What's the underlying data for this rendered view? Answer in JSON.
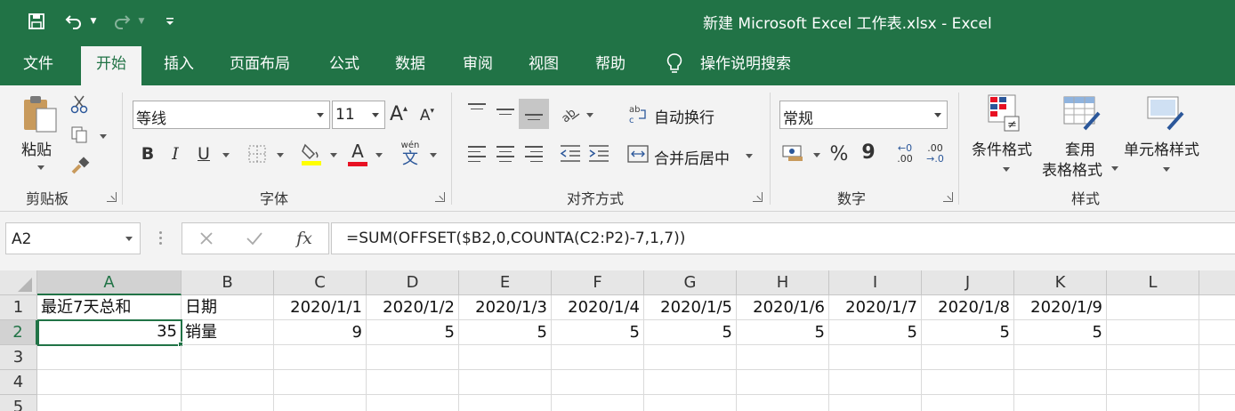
{
  "window": {
    "title": "新建 Microsoft Excel 工作表.xlsx  -  Excel"
  },
  "quick_access": {
    "icons": [
      "save-icon",
      "undo-icon",
      "redo-icon",
      "customize-qat-icon"
    ]
  },
  "tabs": [
    {
      "label": "文件"
    },
    {
      "label": "开始"
    },
    {
      "label": "插入"
    },
    {
      "label": "页面布局"
    },
    {
      "label": "公式"
    },
    {
      "label": "数据"
    },
    {
      "label": "审阅"
    },
    {
      "label": "视图"
    },
    {
      "label": "帮助"
    }
  ],
  "tell_me": {
    "label": "操作说明搜索"
  },
  "ribbon": {
    "clipboard": {
      "label": "剪贴板",
      "paste": "粘贴"
    },
    "font": {
      "label": "字体",
      "font_name": "等线",
      "font_size": "11",
      "bold": "B",
      "italic": "I",
      "underline": "U",
      "grow": "A",
      "shrink": "A",
      "wen": "wén",
      "wen_char": "文",
      "font_color_letter": "A"
    },
    "alignment": {
      "label": "对齐方式",
      "wrap": "自动换行",
      "merge": "合并后居中"
    },
    "number": {
      "label": "数字",
      "format": "常规",
      "percent": "%",
      "comma": "9",
      "inc_dec_top": "←0",
      "inc_dec_bottom": ".00",
      "dec_dec_top": ".00",
      "dec_dec_bottom": "→.0"
    },
    "styles": {
      "label": "样式",
      "conditional": "条件格式",
      "table_1": "套用",
      "table_2": "表格格式",
      "cell_styles": "单元格样式"
    }
  },
  "formula_bar": {
    "name_box": "A2",
    "formula": "=SUM(OFFSET($B2,0,COUNTA(C2:P2)-7,1,7))",
    "fx": "fx"
  },
  "sheet": {
    "columns": [
      "A",
      "B",
      "C",
      "D",
      "E",
      "F",
      "G",
      "H",
      "I",
      "J",
      "K",
      "L"
    ],
    "rows": [
      "1",
      "2",
      "3",
      "4",
      "5"
    ],
    "row1": [
      "最近7天总和",
      "日期",
      "2020/1/1",
      "2020/1/2",
      "2020/1/3",
      "2020/1/4",
      "2020/1/5",
      "2020/1/6",
      "2020/1/7",
      "2020/1/8",
      "2020/1/9",
      ""
    ],
    "row2": [
      "35",
      "销量",
      "9",
      "5",
      "5",
      "5",
      "5",
      "5",
      "5",
      "5",
      "5",
      ""
    ],
    "active_cell": "A2"
  },
  "colors": {
    "excel_green": "#217346",
    "ribbon_bg": "#f3f3f3",
    "font_color_bar": "#e81123",
    "highlight_bar": "#ffff00"
  }
}
